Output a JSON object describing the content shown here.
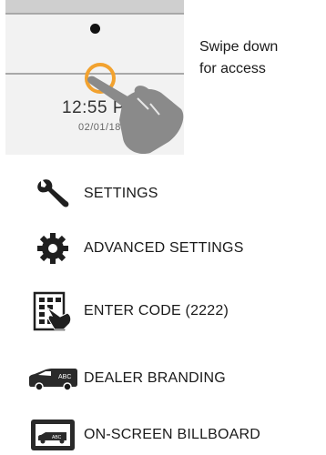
{
  "illustration": {
    "clock_time": "12:55 P",
    "clock_date": "02/01/18",
    "hint_line1": "Swipe down",
    "hint_line2": "for access"
  },
  "menu": {
    "items": [
      {
        "label": "SETTINGS",
        "icon": "wrench-icon"
      },
      {
        "label": "ADVANCED SETTINGS",
        "icon": "gear-icon"
      },
      {
        "label": "ENTER CODE (2222)",
        "icon": "keypad-hand-icon"
      },
      {
        "label": "DEALER BRANDING",
        "icon": "van-icon"
      },
      {
        "label": "ON-SCREEN BILLBOARD",
        "icon": "billboard-icon"
      }
    ]
  },
  "colors": {
    "accent_ring": "#f2a22f",
    "hand_gray": "#8a8a8a",
    "icon_dark": "#1f1f1f"
  }
}
